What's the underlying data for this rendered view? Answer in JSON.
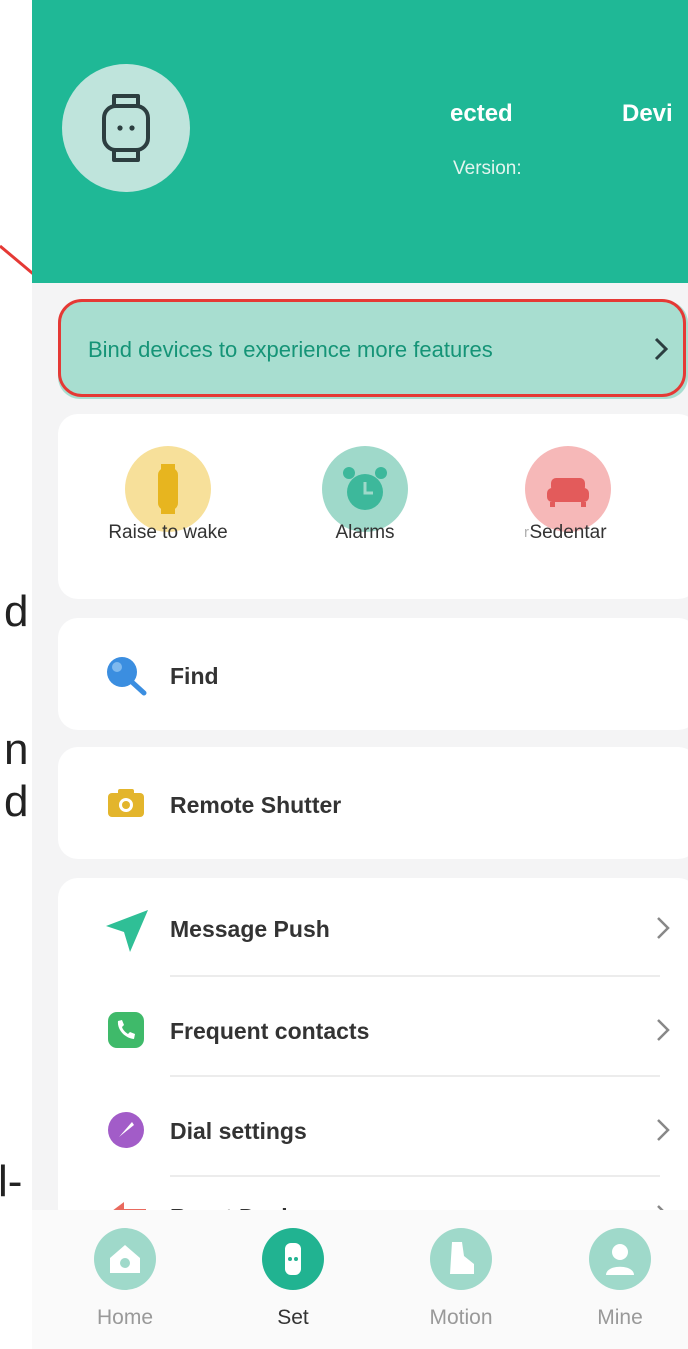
{
  "manual_fragments": [
    "d",
    "n",
    "d",
    "l-"
  ],
  "header": {
    "status_text": "ected",
    "device_text": "Devi",
    "version_label": "Version:"
  },
  "bind_banner": {
    "text": "Bind devices to experience more features"
  },
  "quick_actions": [
    {
      "label": "Raise to wake",
      "icon": "raise-to-wake-icon",
      "color": "#f7e09a"
    },
    {
      "label": "Alarms",
      "icon": "alarm-clock-icon",
      "color": "#9fd9ca"
    },
    {
      "label": "Sedentar",
      "icon": "sofa-icon",
      "color": "#f6b8b8"
    }
  ],
  "quick_extra": "r",
  "menu": {
    "find": "Find",
    "remote_shutter": "Remote Shutter",
    "message_push": "Message Push",
    "frequent_contacts": "Frequent contacts",
    "dial_settings": "Dial settings",
    "reset_device": "Reset Device"
  },
  "tabs": [
    {
      "label": "Home",
      "icon": "home-icon",
      "active": false
    },
    {
      "label": "Set",
      "icon": "watch-icon",
      "active": true
    },
    {
      "label": "Motion",
      "icon": "shoe-icon",
      "active": false
    },
    {
      "label": "Mine",
      "icon": "user-icon",
      "active": false
    }
  ],
  "colors": {
    "header_bg": "#1fb896",
    "banner_bg": "#a8ded0",
    "banner_text": "#159477",
    "highlight": "#e53935",
    "accent": "#21b391"
  }
}
